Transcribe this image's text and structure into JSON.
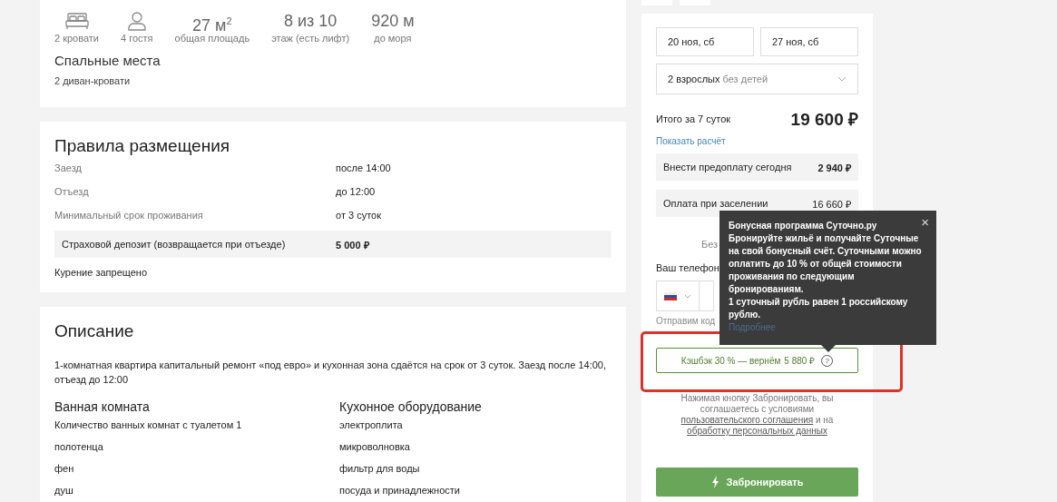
{
  "summary": {
    "stats": [
      {
        "kind": "bed",
        "label": "2 кровати"
      },
      {
        "kind": "person",
        "label": "4 гостя"
      },
      {
        "kind": "value",
        "value": "27 м$^{2}$",
        "label": "общая площадь"
      },
      {
        "kind": "value",
        "value": "8 из 10",
        "label": "этаж (есть лифт)"
      },
      {
        "kind": "value",
        "value": "920 м",
        "label": "до моря"
      }
    ],
    "beds_title": "Спальные места",
    "beds": "2 диван-кровати"
  },
  "rules": {
    "title": "Правила размещения",
    "rows": [
      {
        "label": "Заезд",
        "value": "после 14:00",
        "highlighted": false
      },
      {
        "label": "Отъезд",
        "value": "до 12:00",
        "highlighted": false
      },
      {
        "label": "Минимальный срок проживания",
        "value": "от 3 суток",
        "highlighted": false
      },
      {
        "label": "Страховой депозит (возвращается при отъезде)",
        "value": "5 000 ₽",
        "highlighted": true
      }
    ],
    "note": "Курение запрещено"
  },
  "description": {
    "title": "Описание",
    "text": "1-комнатная квартира капитальный ремонт «под евро» и кухонная зона сдаётся на срок от 3 суток. Заезд после 14:00, отъезд до 12:00",
    "groups": [
      {
        "title": "Ванная комната",
        "items": [
          "Количество ванных комнат с туалетом  1",
          "полотенца",
          "фен",
          "душ"
        ]
      },
      {
        "title": "Кухонное оборудование",
        "items": [
          "электроплита",
          "микроволновка",
          "фильтр для воды",
          "посуда и принадлежности"
        ]
      }
    ]
  },
  "booking": {
    "check_in": "20 ноя, сб",
    "check_out": "27 ноя, сб",
    "guests": "2 взрослых",
    "children": "без детей",
    "total_label": "Итого за 7 суток",
    "total": "19 600 ₽",
    "details_link": "Показать расчёт",
    "payments": [
      {
        "label": "Внести предоплату сегодня",
        "amount": "2 940 ₽",
        "bold": true
      },
      {
        "label": "Оплата при заселении",
        "amount": "16 660 ₽",
        "bold": false
      }
    ],
    "fee_note": "Без",
    "phone_label": "Ваш телефон",
    "phone_hint": "Отправим код",
    "cashback": {
      "label": "Кэшбэк 30 % — вернём",
      "amount": "5 880 ₽",
      "help": "?"
    },
    "terms": {
      "before": "Нажимая кнопку Забронировать, вы соглашаетесь с условиями",
      "link1": "пользовательского соглашения",
      "middle": "и на",
      "link2": "обработку персональных данных"
    },
    "book_button": "Забронировать"
  },
  "tooltip": {
    "title": "Бонусная программа Суточно.ру",
    "text": "Бронируйте жильё и получайте Суточные на свой бонусный счёт. Суточными можно оплатить до 10 % от общей стоимости проживания по следующим бронированиям.",
    "text2": "1 суточный рубль равен 1 российскому рублю.",
    "link": "Подробнее",
    "close": "×"
  }
}
